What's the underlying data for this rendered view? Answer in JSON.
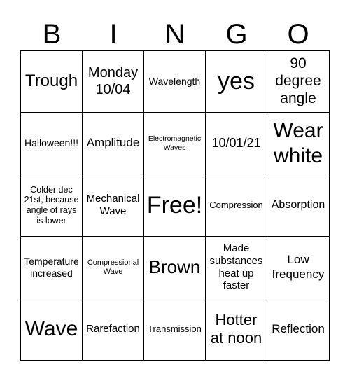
{
  "header": [
    "B",
    "I",
    "N",
    "G",
    "O"
  ],
  "cells": [
    {
      "text": "Trough",
      "size": 24
    },
    {
      "text": "Monday 10/04",
      "size": 20
    },
    {
      "text": "Wavelength",
      "size": 14
    },
    {
      "text": "yes",
      "size": 34
    },
    {
      "text": "90 degree angle",
      "size": 21
    },
    {
      "text": "Halloween!!!",
      "size": 14
    },
    {
      "text": "Amplitude",
      "size": 17
    },
    {
      "text": "Electromagnetic Waves",
      "size": 10.5
    },
    {
      "text": "10/01/21",
      "size": 18
    },
    {
      "text": "Wear white",
      "size": 30
    },
    {
      "text": "Colder dec 21st, because angle of rays is lower",
      "size": 12.5
    },
    {
      "text": "Mechanical Wave",
      "size": 15
    },
    {
      "text": "Free!",
      "size": 34
    },
    {
      "text": "Compression",
      "size": 13
    },
    {
      "text": "Absorption",
      "size": 16
    },
    {
      "text": "Temperature increased",
      "size": 14
    },
    {
      "text": "Compressional Wave",
      "size": 11
    },
    {
      "text": "Brown",
      "size": 26
    },
    {
      "text": "Made substances heat up faster",
      "size": 15
    },
    {
      "text": "Low frequency",
      "size": 17
    },
    {
      "text": "Wave",
      "size": 30
    },
    {
      "text": "Rarefaction",
      "size": 15
    },
    {
      "text": "Transmission",
      "size": 13
    },
    {
      "text": "Hotter at noon",
      "size": 22
    },
    {
      "text": "Reflection",
      "size": 17
    }
  ]
}
